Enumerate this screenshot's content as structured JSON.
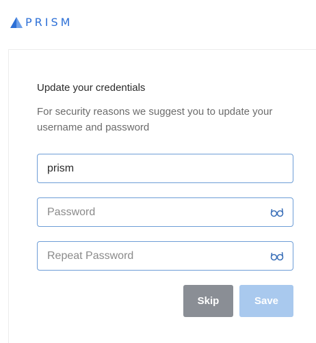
{
  "brand": {
    "name": "PRISM",
    "color": "#2c6fd6"
  },
  "card": {
    "title": "Update your credentials",
    "description": "For security reasons we suggest you to update your username and password"
  },
  "form": {
    "username": {
      "value": "prism",
      "placeholder": ""
    },
    "password": {
      "value": "",
      "placeholder": "Password",
      "icon": "eye-toggle-icon"
    },
    "repeat_password": {
      "value": "",
      "placeholder": "Repeat Password",
      "icon": "eye-toggle-icon"
    }
  },
  "actions": {
    "skip_label": "Skip",
    "save_label": "Save",
    "skip_color": "#8a8e95",
    "save_color": "#a9c9ee"
  }
}
